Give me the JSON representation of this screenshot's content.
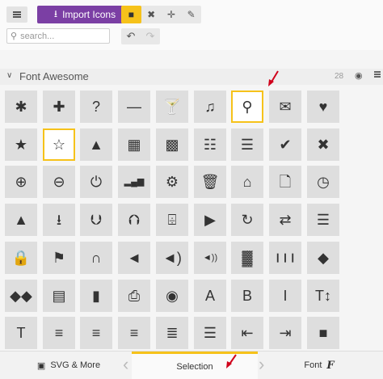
{
  "toolbar": {
    "import_label": "Import Icons",
    "tools": [
      {
        "icon": "select-icon",
        "glyph": "■",
        "active": true
      },
      {
        "icon": "trash-icon",
        "glyph": "✖",
        "active": false
      },
      {
        "icon": "move-icon",
        "glyph": "✛",
        "active": false
      },
      {
        "icon": "pencil-icon",
        "glyph": "✎",
        "active": false
      }
    ]
  },
  "search": {
    "placeholder": "search..."
  },
  "history": {
    "undo": "↶",
    "redo": "↷"
  },
  "icon_set": {
    "title": "Font Awesome",
    "count": "28",
    "collapse_glyph": "∨",
    "eye_glyph": "◉"
  },
  "icons": [
    {
      "name": "asterisk-icon",
      "glyph": "✱"
    },
    {
      "name": "plus-icon",
      "glyph": "✚"
    },
    {
      "name": "question-icon",
      "glyph": "?"
    },
    {
      "name": "minus-icon",
      "glyph": "—"
    },
    {
      "name": "glass-icon",
      "glyph": "🍸"
    },
    {
      "name": "music-icon",
      "glyph": "♫"
    },
    {
      "name": "search-icon",
      "glyph": "⚲",
      "selected": true
    },
    {
      "name": "envelope-icon",
      "glyph": "✉"
    },
    {
      "name": "heart-icon",
      "glyph": "♥"
    },
    {
      "name": "star-icon",
      "glyph": "★"
    },
    {
      "name": "star-empty-icon",
      "glyph": "☆",
      "selected": true
    },
    {
      "name": "user-icon",
      "glyph": "▲"
    },
    {
      "name": "film-icon",
      "glyph": "▦"
    },
    {
      "name": "th-large-icon",
      "glyph": "▩"
    },
    {
      "name": "th-icon",
      "glyph": "☷"
    },
    {
      "name": "th-list-icon",
      "glyph": "☰"
    },
    {
      "name": "ok-icon",
      "glyph": "✔"
    },
    {
      "name": "remove-icon",
      "glyph": "✖"
    },
    {
      "name": "zoom-in-icon",
      "glyph": "⊕"
    },
    {
      "name": "zoom-out-icon",
      "glyph": "⊖"
    },
    {
      "name": "off-icon",
      "glyph": "⏻"
    },
    {
      "name": "signal-icon",
      "glyph": "▂▄▆"
    },
    {
      "name": "cog-icon",
      "glyph": "⚙"
    },
    {
      "name": "trash-icon",
      "glyph": "🗑"
    },
    {
      "name": "home-icon",
      "glyph": "⌂"
    },
    {
      "name": "file-icon",
      "glyph": "🗋"
    },
    {
      "name": "time-icon",
      "glyph": "◷"
    },
    {
      "name": "road-icon",
      "glyph": "▲"
    },
    {
      "name": "download-alt-icon",
      "glyph": "⭳"
    },
    {
      "name": "download-icon",
      "glyph": "⮋"
    },
    {
      "name": "upload-icon",
      "glyph": "⮉"
    },
    {
      "name": "inbox-icon",
      "glyph": "⌹"
    },
    {
      "name": "play-circle-icon",
      "glyph": "▶"
    },
    {
      "name": "repeat-icon",
      "glyph": "↻"
    },
    {
      "name": "refresh-icon",
      "glyph": "⇄"
    },
    {
      "name": "list-alt-icon",
      "glyph": "☰"
    },
    {
      "name": "lock-icon",
      "glyph": "🔒"
    },
    {
      "name": "flag-icon",
      "glyph": "⚑"
    },
    {
      "name": "headphones-icon",
      "glyph": "∩"
    },
    {
      "name": "volume-off-icon",
      "glyph": "◄"
    },
    {
      "name": "volume-down-icon",
      "glyph": "◄)"
    },
    {
      "name": "volume-up-icon",
      "glyph": "◄))"
    },
    {
      "name": "qrcode-icon",
      "glyph": "▓"
    },
    {
      "name": "barcode-icon",
      "glyph": "❙❙❙"
    },
    {
      "name": "tag-icon",
      "glyph": "◆"
    },
    {
      "name": "tags-icon",
      "glyph": "◆◆"
    },
    {
      "name": "book-icon",
      "glyph": "▤"
    },
    {
      "name": "bookmark-icon",
      "glyph": "▮"
    },
    {
      "name": "print-icon",
      "glyph": "⎙"
    },
    {
      "name": "camera-icon",
      "glyph": "◉"
    },
    {
      "name": "font-icon",
      "glyph": "A"
    },
    {
      "name": "bold-icon",
      "glyph": "B"
    },
    {
      "name": "italic-icon",
      "glyph": "I"
    },
    {
      "name": "text-height-icon",
      "glyph": "T↕"
    },
    {
      "name": "text-width-icon",
      "glyph": "T"
    },
    {
      "name": "align-left-icon",
      "glyph": "≡"
    },
    {
      "name": "align-center-icon",
      "glyph": "≡"
    },
    {
      "name": "align-right-icon",
      "glyph": "≡"
    },
    {
      "name": "align-justify-icon",
      "glyph": "≣"
    },
    {
      "name": "list-icon",
      "glyph": "☰"
    },
    {
      "name": "indent-left-icon",
      "glyph": "⇤"
    },
    {
      "name": "indent-right-icon",
      "glyph": "⇥"
    },
    {
      "name": "facetime-video-icon",
      "glyph": "■"
    }
  ],
  "bottom": {
    "svg_label": "SVG & More",
    "selection_label": "Selection",
    "font_label": "Font",
    "font_glyph": "F",
    "left_chevron": "‹",
    "right_chevron": "›"
  },
  "colors": {
    "accent_purple": "#7b3fa4",
    "selection_yellow": "#f6c21a",
    "pointer_red": "#d0021b"
  }
}
